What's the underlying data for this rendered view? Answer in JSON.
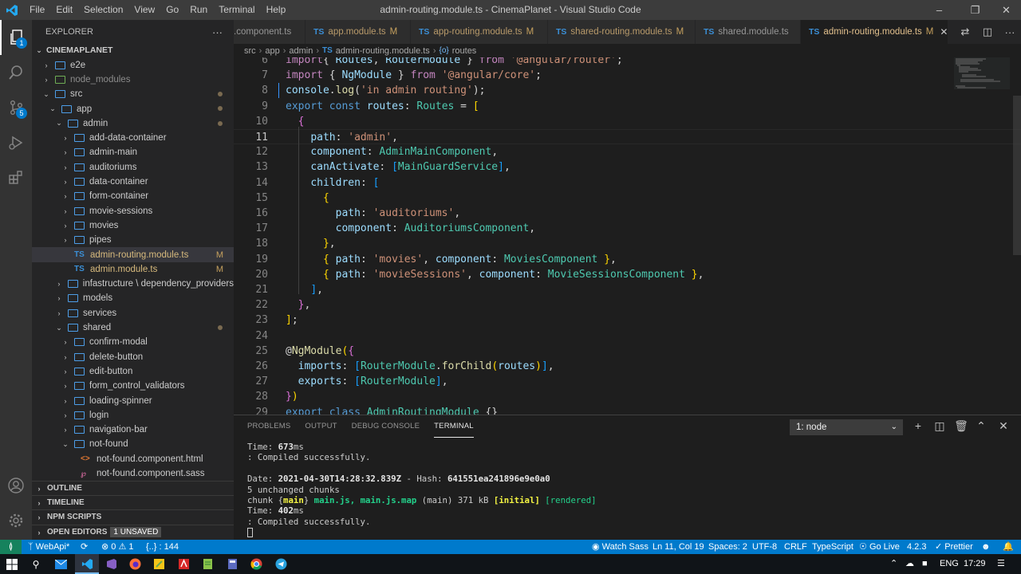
{
  "window": {
    "title": "admin-routing.module.ts - CinemaPlanet - Visual Studio Code",
    "menu": [
      "File",
      "Edit",
      "Selection",
      "View",
      "Go",
      "Run",
      "Terminal",
      "Help"
    ]
  },
  "activity_bar": {
    "explorer_badge": "1",
    "scm_badge": "5"
  },
  "sidebar": {
    "header": "EXPLORER",
    "root": "CINEMAPLANET",
    "items": [
      {
        "label": "e2e",
        "depth": 1,
        "type": "folder",
        "expanded": false
      },
      {
        "label": "node_modules",
        "depth": 1,
        "type": "folder-green",
        "expanded": false,
        "dim": true
      },
      {
        "label": "src",
        "depth": 1,
        "type": "folder",
        "expanded": true,
        "mod": "dot"
      },
      {
        "label": "app",
        "depth": 2,
        "type": "folder",
        "expanded": true,
        "mod": "dot"
      },
      {
        "label": "admin",
        "depth": 3,
        "type": "folder",
        "expanded": true,
        "mod": "dot"
      },
      {
        "label": "add-data-container",
        "depth": 4,
        "type": "folder",
        "expanded": false
      },
      {
        "label": "admin-main",
        "depth": 4,
        "type": "folder",
        "expanded": false
      },
      {
        "label": "auditoriums",
        "depth": 4,
        "type": "folder",
        "expanded": false
      },
      {
        "label": "data-container",
        "depth": 4,
        "type": "folder",
        "expanded": false
      },
      {
        "label": "form-container",
        "depth": 4,
        "type": "folder",
        "expanded": false
      },
      {
        "label": "movie-sessions",
        "depth": 4,
        "type": "folder",
        "expanded": false
      },
      {
        "label": "movies",
        "depth": 4,
        "type": "folder",
        "expanded": false
      },
      {
        "label": "pipes",
        "depth": 4,
        "type": "folder",
        "expanded": false
      },
      {
        "label": "admin-routing.module.ts",
        "depth": 4,
        "type": "ts",
        "mod": "M",
        "selected": true
      },
      {
        "label": "admin.module.ts",
        "depth": 4,
        "type": "ts",
        "mod": "M"
      },
      {
        "label": "infastructure \\ dependency_providers",
        "depth": 3,
        "type": "folder",
        "expanded": false
      },
      {
        "label": "models",
        "depth": 3,
        "type": "folder",
        "expanded": false
      },
      {
        "label": "services",
        "depth": 3,
        "type": "folder",
        "expanded": false
      },
      {
        "label": "shared",
        "depth": 3,
        "type": "folder",
        "expanded": true,
        "mod": "dot"
      },
      {
        "label": "confirm-modal",
        "depth": 4,
        "type": "folder",
        "expanded": false
      },
      {
        "label": "delete-button",
        "depth": 4,
        "type": "folder",
        "expanded": false
      },
      {
        "label": "edit-button",
        "depth": 4,
        "type": "folder",
        "expanded": false
      },
      {
        "label": "form_control_validators",
        "depth": 4,
        "type": "folder",
        "expanded": false
      },
      {
        "label": "loading-spinner",
        "depth": 4,
        "type": "folder",
        "expanded": false
      },
      {
        "label": "login",
        "depth": 4,
        "type": "folder",
        "expanded": false
      },
      {
        "label": "navigation-bar",
        "depth": 4,
        "type": "folder",
        "expanded": false
      },
      {
        "label": "not-found",
        "depth": 4,
        "type": "folder",
        "expanded": true
      },
      {
        "label": "not-found.component.html",
        "depth": 5,
        "type": "html"
      },
      {
        "label": "not-found.component.sass",
        "depth": 5,
        "type": "sass"
      }
    ],
    "sections": {
      "outline": "OUTLINE",
      "timeline": "TIMELINE",
      "npm": "NPM SCRIPTS",
      "open_editors": "OPEN EDITORS",
      "unsaved": "1 UNSAVED"
    }
  },
  "tabs": [
    {
      "label": ".component.ts",
      "icon": "",
      "mod": ""
    },
    {
      "label": "app.module.ts",
      "icon": "TS",
      "mod": "M"
    },
    {
      "label": "app-routing.module.ts",
      "icon": "TS",
      "mod": "M"
    },
    {
      "label": "shared-routing.module.ts",
      "icon": "TS",
      "mod": "M"
    },
    {
      "label": "shared.module.ts",
      "icon": "TS",
      "mod": ""
    },
    {
      "label": "admin-routing.module.ts",
      "icon": "TS",
      "mod": "M",
      "active": true
    }
  ],
  "breadcrumb": {
    "parts": [
      "src",
      "app",
      "admin"
    ],
    "file": "admin-routing.module.ts",
    "symbol": "routes",
    "file_icon": "TS",
    "symbol_icon": "{o}"
  },
  "editor": {
    "current_line": 11,
    "lines": [
      {
        "n": 6,
        "tokens": [
          [
            "ctl",
            "import"
          ],
          [
            "",
            "{ "
          ],
          [
            "ident",
            "Routes"
          ],
          [
            "",
            ", "
          ],
          [
            "ident",
            "RouterModule"
          ],
          [
            "",
            " } "
          ],
          [
            "ctl",
            "from"
          ],
          [
            "",
            " "
          ],
          [
            "str",
            "'@angular/router'"
          ],
          [
            "",
            ";"
          ]
        ]
      },
      {
        "n": 7,
        "tokens": [
          [
            "ctl",
            "import"
          ],
          [
            "",
            " { "
          ],
          [
            "ident",
            "NgModule"
          ],
          [
            "",
            " } "
          ],
          [
            "ctl",
            "from"
          ],
          [
            "",
            " "
          ],
          [
            "str",
            "'@angular/core'"
          ],
          [
            "",
            ";"
          ]
        ]
      },
      {
        "n": 8,
        "tokens": [
          [
            "ident",
            "console"
          ],
          [
            "",
            "."
          ],
          [
            "fn",
            "log"
          ],
          [
            "",
            "("
          ],
          [
            "str",
            "'in admin routing'"
          ],
          [
            "",
            ");"
          ]
        ]
      },
      {
        "n": 9,
        "tokens": [
          [
            "kw",
            "export"
          ],
          [
            "",
            " "
          ],
          [
            "kw",
            "const"
          ],
          [
            "",
            " "
          ],
          [
            "ident",
            "routes"
          ],
          [
            "",
            ": "
          ],
          [
            "typ",
            "Routes"
          ],
          [
            "",
            " = "
          ],
          [
            "br1",
            "["
          ]
        ]
      },
      {
        "n": 10,
        "tokens": [
          [
            "",
            "  "
          ],
          [
            "br2",
            "{"
          ]
        ]
      },
      {
        "n": 11,
        "tokens": [
          [
            "",
            "    "
          ],
          [
            "prop",
            "path"
          ],
          [
            "",
            ": "
          ],
          [
            "str",
            "'admin'"
          ],
          [
            "",
            ","
          ]
        ]
      },
      {
        "n": 12,
        "tokens": [
          [
            "",
            "    "
          ],
          [
            "prop",
            "component"
          ],
          [
            "",
            ": "
          ],
          [
            "typ",
            "AdminMainComponent"
          ],
          [
            "",
            ","
          ]
        ]
      },
      {
        "n": 13,
        "tokens": [
          [
            "",
            "    "
          ],
          [
            "prop",
            "canActivate"
          ],
          [
            "",
            ": "
          ],
          [
            "br3",
            "["
          ],
          [
            "typ",
            "MainGuardService"
          ],
          [
            "br3",
            "]"
          ],
          [
            "",
            ","
          ]
        ]
      },
      {
        "n": 14,
        "tokens": [
          [
            "",
            "    "
          ],
          [
            "prop",
            "children"
          ],
          [
            "",
            ": "
          ],
          [
            "br3",
            "["
          ]
        ]
      },
      {
        "n": 15,
        "tokens": [
          [
            "",
            "      "
          ],
          [
            "br1",
            "{"
          ]
        ]
      },
      {
        "n": 16,
        "tokens": [
          [
            "",
            "        "
          ],
          [
            "prop",
            "path"
          ],
          [
            "",
            ": "
          ],
          [
            "str",
            "'auditoriums'"
          ],
          [
            "",
            ","
          ]
        ]
      },
      {
        "n": 17,
        "tokens": [
          [
            "",
            "        "
          ],
          [
            "prop",
            "component"
          ],
          [
            "",
            ": "
          ],
          [
            "typ",
            "AuditoriumsComponent"
          ],
          [
            "",
            ","
          ]
        ]
      },
      {
        "n": 18,
        "tokens": [
          [
            "",
            "      "
          ],
          [
            "br1",
            "}"
          ],
          [
            "",
            ","
          ]
        ]
      },
      {
        "n": 19,
        "tokens": [
          [
            "",
            "      "
          ],
          [
            "br1",
            "{"
          ],
          [
            "",
            " "
          ],
          [
            "prop",
            "path"
          ],
          [
            "",
            ": "
          ],
          [
            "str",
            "'movies'"
          ],
          [
            "",
            ", "
          ],
          [
            "prop",
            "component"
          ],
          [
            "",
            ": "
          ],
          [
            "typ",
            "MoviesComponent"
          ],
          [
            "",
            " "
          ],
          [
            "br1",
            "}"
          ],
          [
            "",
            ","
          ]
        ]
      },
      {
        "n": 20,
        "tokens": [
          [
            "",
            "      "
          ],
          [
            "br1",
            "{"
          ],
          [
            "",
            " "
          ],
          [
            "prop",
            "path"
          ],
          [
            "",
            ": "
          ],
          [
            "str",
            "'movieSessions'"
          ],
          [
            "",
            ", "
          ],
          [
            "prop",
            "component"
          ],
          [
            "",
            ": "
          ],
          [
            "typ",
            "MovieSessionsComponent"
          ],
          [
            "",
            " "
          ],
          [
            "br1",
            "}"
          ],
          [
            "",
            ","
          ]
        ]
      },
      {
        "n": 21,
        "tokens": [
          [
            "",
            "    "
          ],
          [
            "br3",
            "]"
          ],
          [
            "",
            ","
          ]
        ]
      },
      {
        "n": 22,
        "tokens": [
          [
            "",
            "  "
          ],
          [
            "br2",
            "}"
          ],
          [
            "",
            ","
          ]
        ]
      },
      {
        "n": 23,
        "tokens": [
          [
            "br1",
            "]"
          ],
          [
            "",
            ";"
          ]
        ]
      },
      {
        "n": 24,
        "tokens": []
      },
      {
        "n": 25,
        "tokens": [
          [
            "",
            "@"
          ],
          [
            "fn",
            "NgModule"
          ],
          [
            "br1",
            "("
          ],
          [
            "br2",
            "{"
          ]
        ]
      },
      {
        "n": 26,
        "tokens": [
          [
            "",
            "  "
          ],
          [
            "prop",
            "imports"
          ],
          [
            "",
            ": "
          ],
          [
            "br3",
            "["
          ],
          [
            "typ",
            "RouterModule"
          ],
          [
            "",
            "."
          ],
          [
            "fn",
            "forChild"
          ],
          [
            "br1",
            "("
          ],
          [
            "ident",
            "routes"
          ],
          [
            "br1",
            ")"
          ],
          [
            "br3",
            "]"
          ],
          [
            "",
            ","
          ]
        ]
      },
      {
        "n": 27,
        "tokens": [
          [
            "",
            "  "
          ],
          [
            "prop",
            "exports"
          ],
          [
            "",
            ": "
          ],
          [
            "br3",
            "["
          ],
          [
            "typ",
            "RouterModule"
          ],
          [
            "br3",
            "]"
          ],
          [
            "",
            ","
          ]
        ]
      },
      {
        "n": 28,
        "tokens": [
          [
            "br2",
            "}"
          ],
          [
            "br1",
            ")"
          ]
        ]
      },
      {
        "n": 29,
        "tokens": [
          [
            "kw",
            "export"
          ],
          [
            "",
            " "
          ],
          [
            "kw",
            "class"
          ],
          [
            "",
            " "
          ],
          [
            "typ",
            "AdminRoutingModule"
          ],
          [
            "",
            " {}"
          ]
        ]
      }
    ]
  },
  "panel": {
    "tabs": [
      "PROBLEMS",
      "OUTPUT",
      "DEBUG CONSOLE",
      "TERMINAL"
    ],
    "active_tab": "TERMINAL",
    "terminal_select": "1: node",
    "terminal_lines": [
      [
        [
          "",
          "Time: "
        ],
        [
          "tb",
          "673"
        ],
        [
          "",
          "ms"
        ]
      ],
      [
        [
          "",
          ": Compiled successfully."
        ]
      ],
      [
        [
          "",
          ""
        ]
      ],
      [
        [
          "",
          "Date: "
        ],
        [
          "tb",
          "2021-04-30T14:28:32.839Z"
        ],
        [
          "",
          " - Hash: "
        ],
        [
          "tb",
          "641551ea241896e9e0a0"
        ]
      ],
      [
        [
          "",
          "5 unchanged chunks"
        ]
      ],
      [
        [
          "",
          "chunk {"
        ],
        [
          "ty",
          "main"
        ],
        [
          "",
          "} "
        ],
        [
          "tg",
          "main.js, main.js.map"
        ],
        [
          "",
          " (main) 371 kB "
        ],
        [
          "ty",
          "[initial]"
        ],
        [
          "",
          " "
        ],
        [
          "tgg",
          "[rendered]"
        ]
      ],
      [
        [
          "",
          "Time: "
        ],
        [
          "tb",
          "402"
        ],
        [
          "",
          "ms"
        ]
      ],
      [
        [
          "",
          ": Compiled successfully."
        ]
      ]
    ]
  },
  "statusbar": {
    "branch": "WebApi*",
    "errors": "0",
    "warnings": "1",
    "symbols": "{..} : 144",
    "watch_sass": "Watch Sass",
    "position": "Ln 11, Col 19",
    "spaces": "Spaces: 2",
    "encoding": "UTF-8",
    "eol": "CRLF",
    "language": "TypeScript",
    "go_live": "Go Live",
    "version": "4.2.3",
    "prettier": "Prettier"
  },
  "taskbar": {
    "lang": "ENG",
    "time": "17:29"
  },
  "colors": {
    "accent": "#007acc",
    "remote": "#16825d",
    "activity_bar": "#333333",
    "sidebar": "#252526",
    "editor": "#1e1e1e"
  }
}
